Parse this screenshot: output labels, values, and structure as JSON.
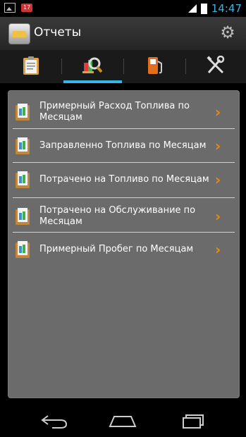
{
  "status_bar": {
    "notification_badge": "17",
    "time": "14:47"
  },
  "action_bar": {
    "title": "Отчеты",
    "app_icon": "car-icon",
    "settings_icon": "gear-icon"
  },
  "tabs": [
    {
      "name": "clipboard-icon",
      "active": false
    },
    {
      "name": "report-search-icon",
      "active": true
    },
    {
      "name": "fuel-pump-icon",
      "active": false
    },
    {
      "name": "tools-icon",
      "active": false
    }
  ],
  "reports": [
    {
      "label": "Примерный Расход Топлива по Месяцам"
    },
    {
      "label": "Заправленно Топлива по Месяцам"
    },
    {
      "label": "Потрачено на Топливо по Месяцам"
    },
    {
      "label": "Потрачено на Обслуживание по Месяцам"
    },
    {
      "label": "Примерный Пробег по Месяцам"
    }
  ],
  "colors": {
    "accent": "#33b5e5",
    "chevron": "#f08a00",
    "panel": "#6b6b6b"
  }
}
